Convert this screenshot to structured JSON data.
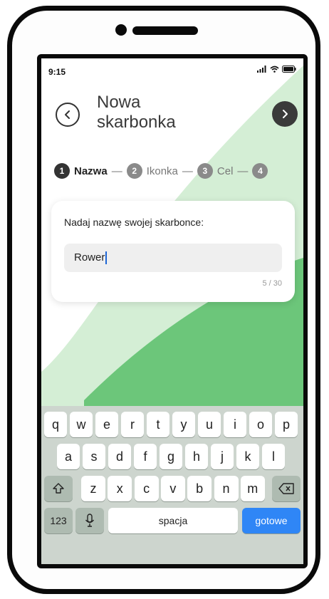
{
  "status_bar": {
    "time": "9:15"
  },
  "header": {
    "title": "Nowa skarbonka",
    "back_icon": "chevron-left-icon",
    "next_icon": "chevron-right-icon"
  },
  "stepper": [
    {
      "number": "1",
      "label": "Nazwa",
      "active": true
    },
    {
      "number": "2",
      "label": "Ikonka",
      "active": false
    },
    {
      "number": "3",
      "label": "Cel",
      "active": false
    },
    {
      "number": "4",
      "label": "",
      "active": false
    }
  ],
  "form": {
    "label": "Nadaj nazwę swojej skarbonce:",
    "value": "Rower",
    "counter": "5 / 30"
  },
  "keyboard": {
    "row1": [
      "q",
      "w",
      "e",
      "r",
      "t",
      "y",
      "u",
      "i",
      "o",
      "p"
    ],
    "row2": [
      "a",
      "s",
      "d",
      "f",
      "g",
      "h",
      "j",
      "k",
      "l"
    ],
    "row3": [
      "z",
      "x",
      "c",
      "v",
      "b",
      "n",
      "m"
    ],
    "numbers_label": "123",
    "space_label": "spacja",
    "done_label": "gotowe"
  },
  "colors": {
    "accent_green": "#6cc67a",
    "light_green": "#d4eed5",
    "done_blue": "#2f86f6"
  }
}
